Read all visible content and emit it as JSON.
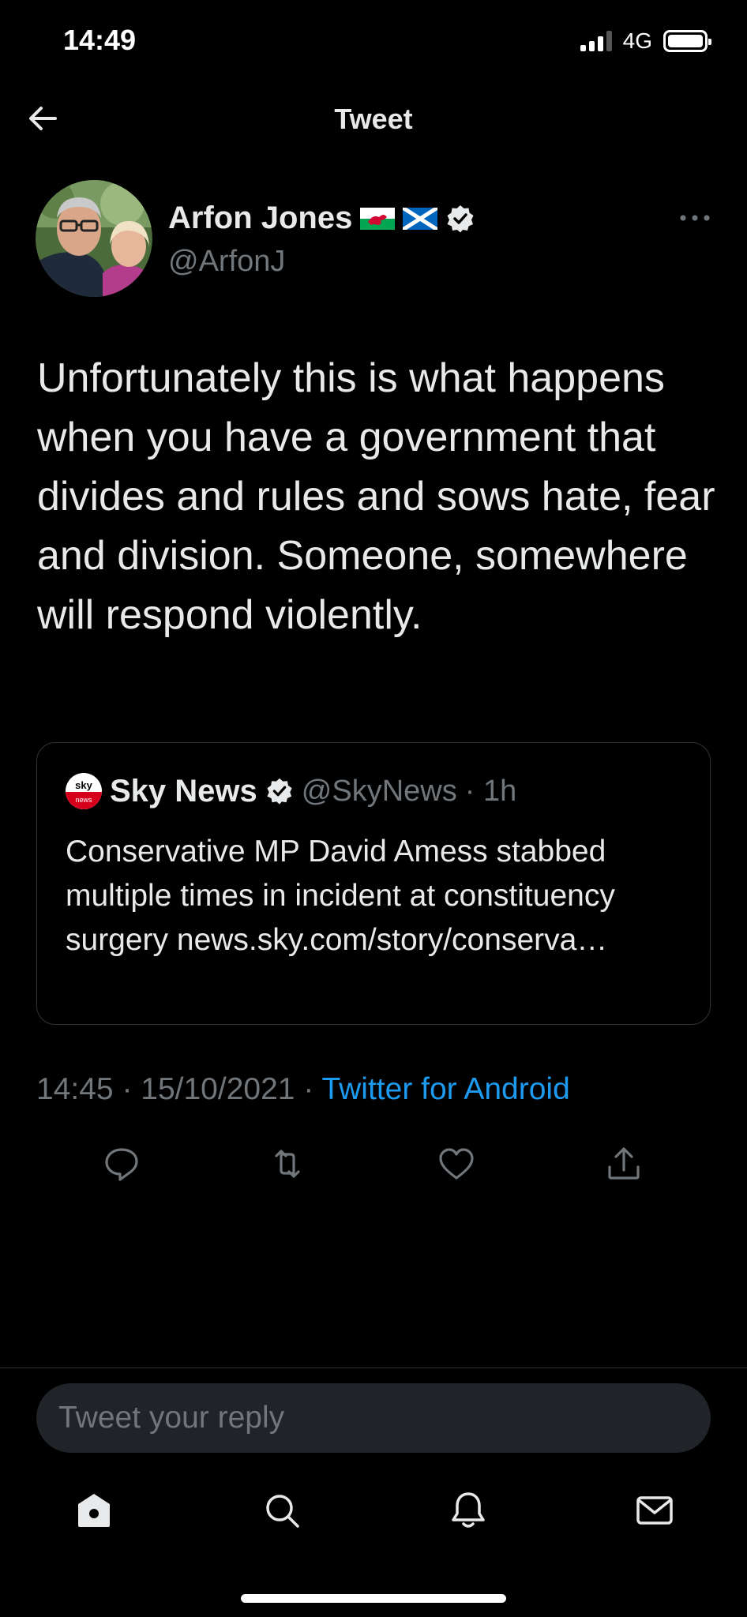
{
  "status_bar": {
    "time": "14:49",
    "network": "4G"
  },
  "header": {
    "title": "Tweet"
  },
  "author": {
    "name": "Arfon Jones",
    "handle": "@ArfonJ"
  },
  "tweet": {
    "text": "Unfortunately this is what happens when you have a government that divides and rules and sows hate, fear and division. Someone, somewhere will respond violently."
  },
  "quote": {
    "name": "Sky News",
    "handle": "@SkyNews",
    "time": "· 1h",
    "logo_text": "sky",
    "logo_sub": "news",
    "text": "Conservative MP David Amess stabbed multiple times in incident at constituency surgery news.sky.com/story/conserva…"
  },
  "meta": {
    "time": "14:45",
    "sep1": " · ",
    "date": "15/10/2021",
    "sep2": " · ",
    "source": "Twitter for Android"
  },
  "reply": {
    "placeholder": "Tweet your reply"
  },
  "colors": {
    "background": "#000000",
    "text": "#e7e9ea",
    "muted": "#71767b",
    "accent": "#1d9bf0"
  }
}
